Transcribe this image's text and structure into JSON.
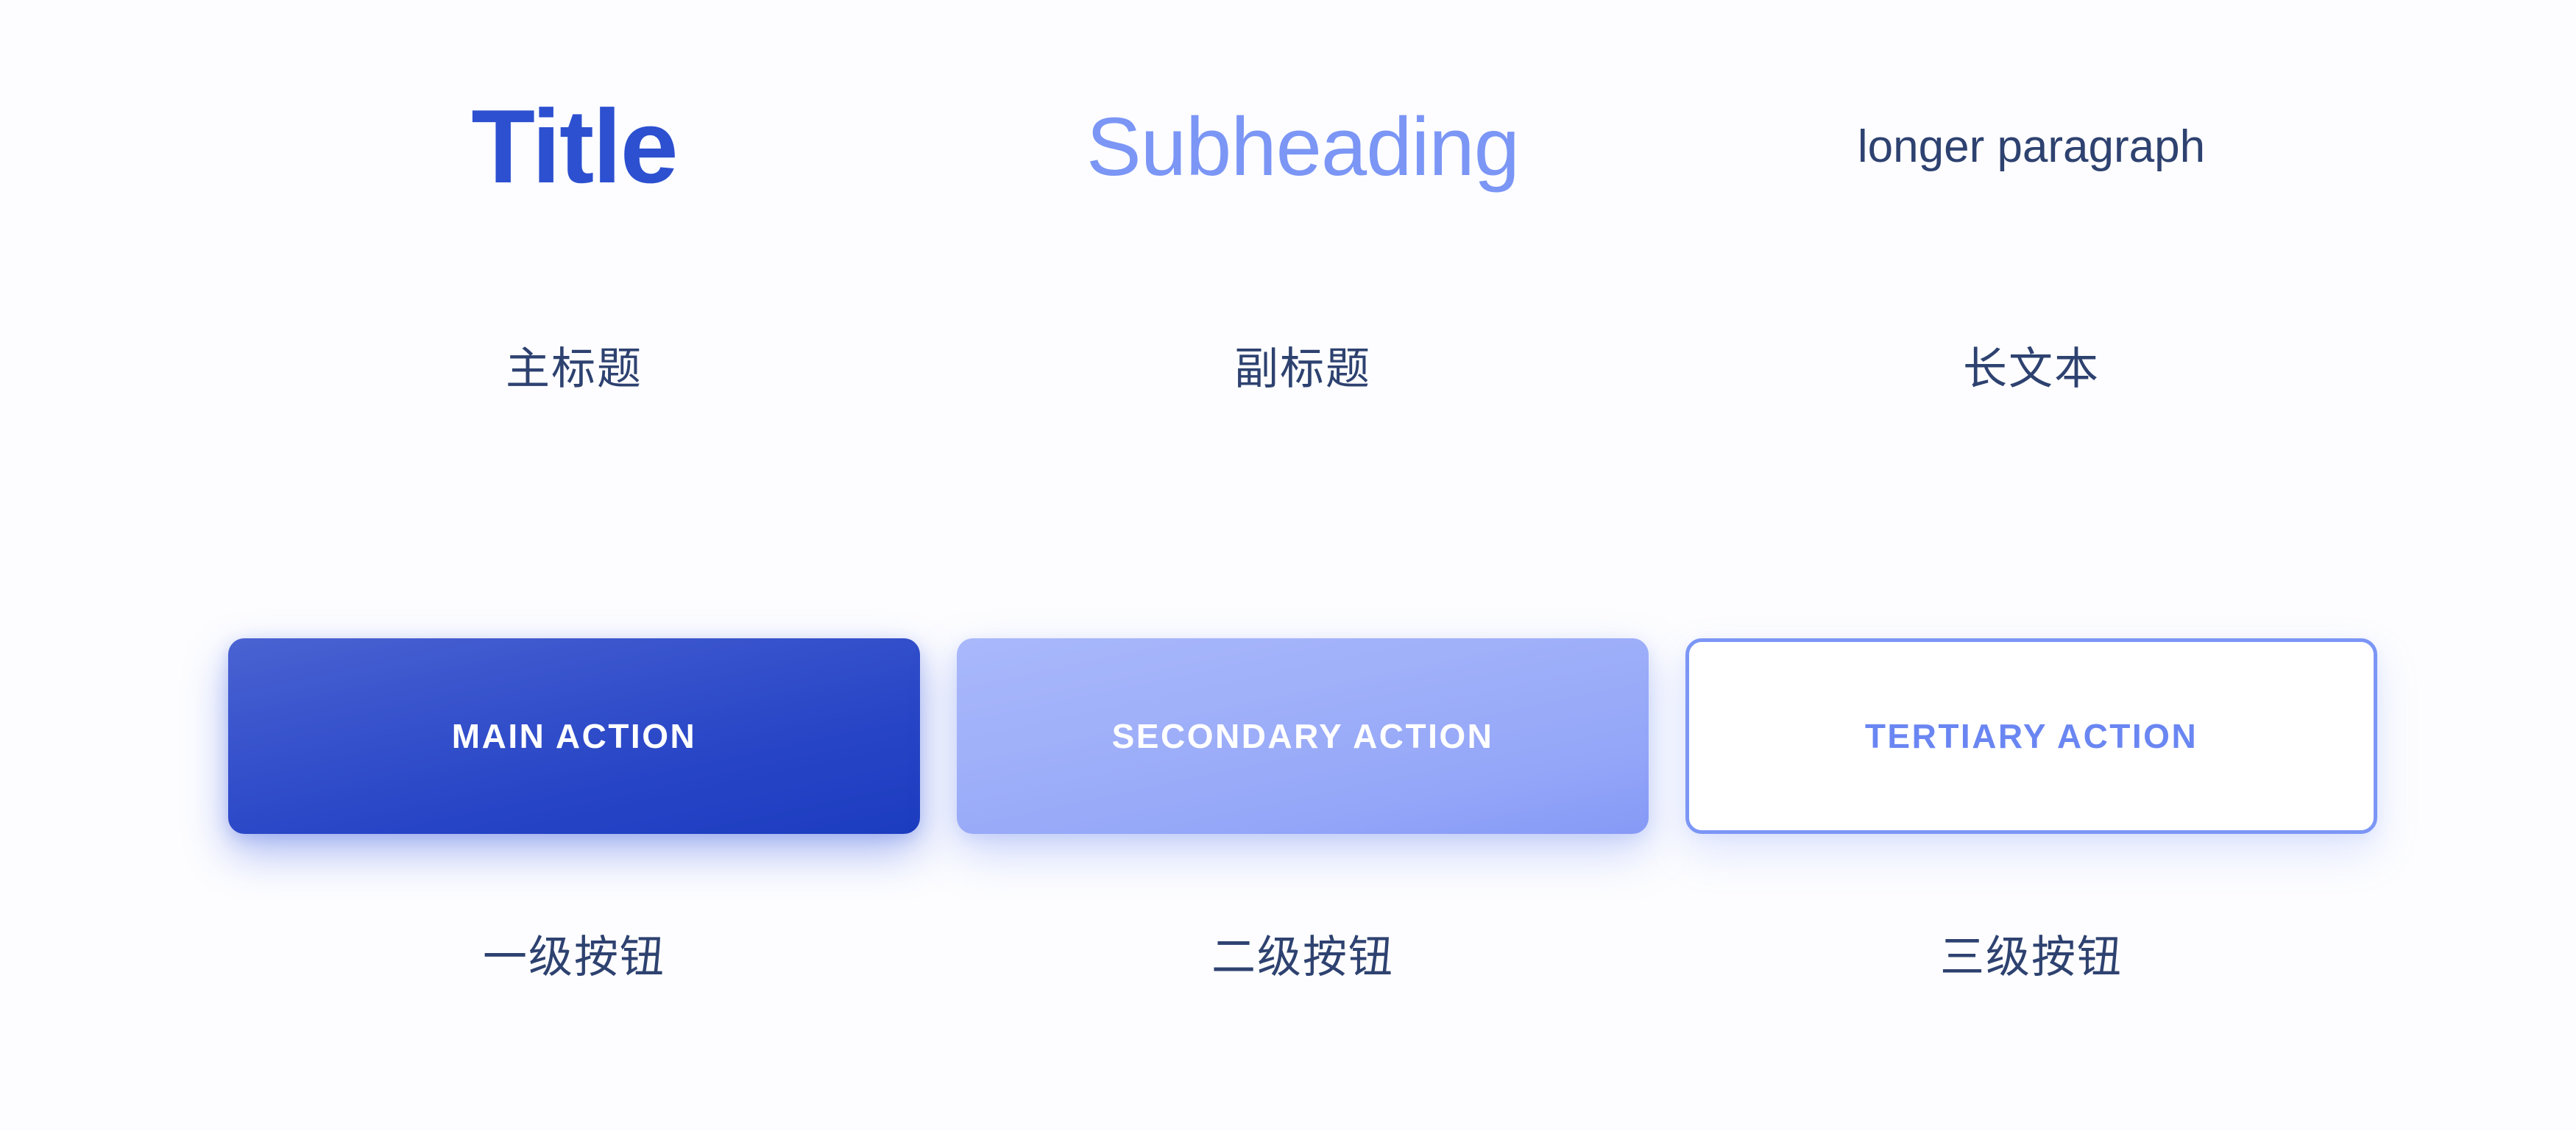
{
  "canvas": {
    "background_color": "#fdfdff"
  },
  "palette": {
    "title_blue": "#2d50d0",
    "subheading_blue": "#7b96f5",
    "paragraph_navy": "#2e4270",
    "caption_navy": "#2e4270",
    "primary_gradient_start": "#4a63d2",
    "primary_gradient_end": "#1c3cc0",
    "secondary_gradient_start": "#a9b8fb",
    "secondary_gradient_end": "#8699f6",
    "tertiary_border": "#7b96f5",
    "tertiary_text": "#6a86f2",
    "button_text_light": "#ffffff"
  },
  "type_specimens": [
    {
      "sample": "Title",
      "caption": "主标题"
    },
    {
      "sample": "Subheading",
      "caption": "副标题"
    },
    {
      "sample": "longer paragraph",
      "caption": "长文本"
    }
  ],
  "buttons": [
    {
      "label": "MAIN ACTION",
      "caption": "一级按钮"
    },
    {
      "label": "SECONDARY ACTION",
      "caption": "二级按钮"
    },
    {
      "label": "TERTIARY ACTION",
      "caption": "三级按钮"
    }
  ]
}
